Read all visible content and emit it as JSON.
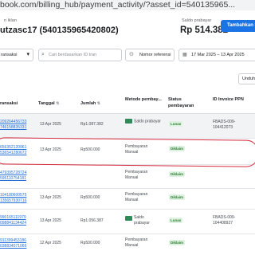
{
  "browser": {
    "url": "book.com/billing_hub/payment_activity/?asset_id=540135965..."
  },
  "account": {
    "label": "n iklan",
    "name": "utzasc17 (540135965420802)",
    "balance_label": "Saldo prabayar",
    "balance_value": "Rp 514.382",
    "add_funds_button": "Tambahkan dana"
  },
  "filters": {
    "type_select": "ransaksi",
    "search_placeholder": "Cari berdasarkan ID tran",
    "reference_button": "Nomor referensi",
    "date_range": "17 Mar 2025 – 13 Apr 2025",
    "download_button": "Unduh"
  },
  "table": {
    "columns": [
      "ransaksi",
      "Tanggal",
      "Jumlah",
      "Metode pembay...",
      "Status pembayaran",
      "ID Invoice PPN"
    ],
    "rows": [
      {
        "txid": [
          "209264456733",
          "746158835331"
        ],
        "date": "13 Apr 2025",
        "amount": "Rp1.087.382",
        "method": "Saldo prabayar",
        "status": "Lunas",
        "invoice": "FBADS-009-104412073"
      },
      {
        "txid": [
          "656352120961",
          "536541280672"
        ],
        "date": "13 Apr 2025",
        "amount": "Rp500.000",
        "method": "Pembayaran Manual",
        "status": "Diklaim",
        "invoice": ""
      },
      {
        "txid": [
          "479395728724",
          "595110754181"
        ],
        "date": "",
        "amount": "",
        "method": "Pembayaran Manual",
        "status": "Diklaim",
        "invoice": ""
      },
      {
        "txid": [
          "104180600575",
          "135657930716"
        ],
        "date": "13 Apr 2025",
        "amount": "Rp500.000",
        "method": "Pembayaran Manual",
        "status": "Diklaim",
        "invoice": ""
      },
      {
        "txid": [
          "990165111979",
          "098841134424"
        ],
        "date": "13 Apr 2025",
        "amount": "Rp1.056.387",
        "method": "Saldo prabayar",
        "status": "Lunas",
        "invoice": "FBADS-009-104408927"
      },
      {
        "txid": [
          "911399453186",
          "038834071066"
        ],
        "date": "12 Apr 2025",
        "amount": "Rp500.000",
        "method": "Pembayaran Manual",
        "status": "Diklaim",
        "invoice": ""
      }
    ]
  },
  "colors": {
    "accent": "#1b74e4",
    "link": "#216fdb",
    "annotation": "#d6283c",
    "paid_badge": "#def2e1"
  },
  "icons": {
    "dropdown": "chevron-down-icon",
    "search": "search-icon",
    "reference": "hash-icon",
    "date": "calendar-icon",
    "payment": "wallet-icon"
  }
}
